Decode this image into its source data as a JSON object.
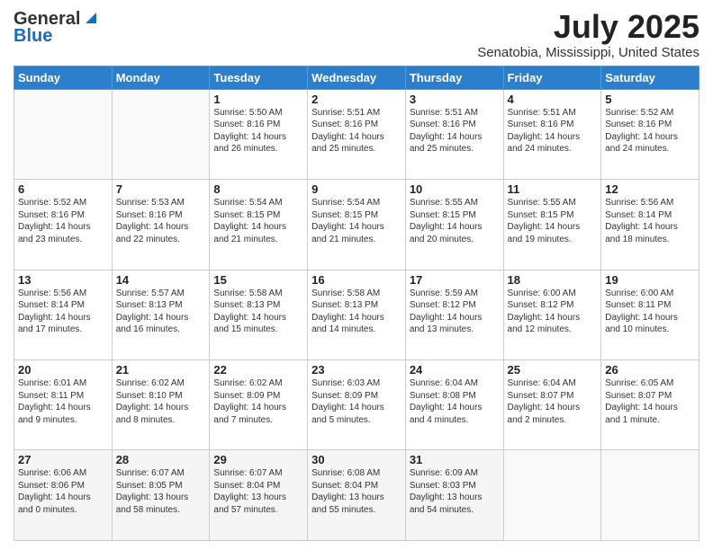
{
  "logo": {
    "line1": "General",
    "line2": "Blue"
  },
  "header": {
    "month": "July 2025",
    "location": "Senatobia, Mississippi, United States"
  },
  "weekdays": [
    "Sunday",
    "Monday",
    "Tuesday",
    "Wednesday",
    "Thursday",
    "Friday",
    "Saturday"
  ],
  "weeks": [
    [
      {
        "day": "",
        "sunrise": "",
        "sunset": "",
        "daylight": ""
      },
      {
        "day": "",
        "sunrise": "",
        "sunset": "",
        "daylight": ""
      },
      {
        "day": "1",
        "sunrise": "Sunrise: 5:50 AM",
        "sunset": "Sunset: 8:16 PM",
        "daylight": "Daylight: 14 hours and 26 minutes."
      },
      {
        "day": "2",
        "sunrise": "Sunrise: 5:51 AM",
        "sunset": "Sunset: 8:16 PM",
        "daylight": "Daylight: 14 hours and 25 minutes."
      },
      {
        "day": "3",
        "sunrise": "Sunrise: 5:51 AM",
        "sunset": "Sunset: 8:16 PM",
        "daylight": "Daylight: 14 hours and 25 minutes."
      },
      {
        "day": "4",
        "sunrise": "Sunrise: 5:51 AM",
        "sunset": "Sunset: 8:16 PM",
        "daylight": "Daylight: 14 hours and 24 minutes."
      },
      {
        "day": "5",
        "sunrise": "Sunrise: 5:52 AM",
        "sunset": "Sunset: 8:16 PM",
        "daylight": "Daylight: 14 hours and 24 minutes."
      }
    ],
    [
      {
        "day": "6",
        "sunrise": "Sunrise: 5:52 AM",
        "sunset": "Sunset: 8:16 PM",
        "daylight": "Daylight: 14 hours and 23 minutes."
      },
      {
        "day": "7",
        "sunrise": "Sunrise: 5:53 AM",
        "sunset": "Sunset: 8:16 PM",
        "daylight": "Daylight: 14 hours and 22 minutes."
      },
      {
        "day": "8",
        "sunrise": "Sunrise: 5:54 AM",
        "sunset": "Sunset: 8:15 PM",
        "daylight": "Daylight: 14 hours and 21 minutes."
      },
      {
        "day": "9",
        "sunrise": "Sunrise: 5:54 AM",
        "sunset": "Sunset: 8:15 PM",
        "daylight": "Daylight: 14 hours and 21 minutes."
      },
      {
        "day": "10",
        "sunrise": "Sunrise: 5:55 AM",
        "sunset": "Sunset: 8:15 PM",
        "daylight": "Daylight: 14 hours and 20 minutes."
      },
      {
        "day": "11",
        "sunrise": "Sunrise: 5:55 AM",
        "sunset": "Sunset: 8:15 PM",
        "daylight": "Daylight: 14 hours and 19 minutes."
      },
      {
        "day": "12",
        "sunrise": "Sunrise: 5:56 AM",
        "sunset": "Sunset: 8:14 PM",
        "daylight": "Daylight: 14 hours and 18 minutes."
      }
    ],
    [
      {
        "day": "13",
        "sunrise": "Sunrise: 5:56 AM",
        "sunset": "Sunset: 8:14 PM",
        "daylight": "Daylight: 14 hours and 17 minutes."
      },
      {
        "day": "14",
        "sunrise": "Sunrise: 5:57 AM",
        "sunset": "Sunset: 8:13 PM",
        "daylight": "Daylight: 14 hours and 16 minutes."
      },
      {
        "day": "15",
        "sunrise": "Sunrise: 5:58 AM",
        "sunset": "Sunset: 8:13 PM",
        "daylight": "Daylight: 14 hours and 15 minutes."
      },
      {
        "day": "16",
        "sunrise": "Sunrise: 5:58 AM",
        "sunset": "Sunset: 8:13 PM",
        "daylight": "Daylight: 14 hours and 14 minutes."
      },
      {
        "day": "17",
        "sunrise": "Sunrise: 5:59 AM",
        "sunset": "Sunset: 8:12 PM",
        "daylight": "Daylight: 14 hours and 13 minutes."
      },
      {
        "day": "18",
        "sunrise": "Sunrise: 6:00 AM",
        "sunset": "Sunset: 8:12 PM",
        "daylight": "Daylight: 14 hours and 12 minutes."
      },
      {
        "day": "19",
        "sunrise": "Sunrise: 6:00 AM",
        "sunset": "Sunset: 8:11 PM",
        "daylight": "Daylight: 14 hours and 10 minutes."
      }
    ],
    [
      {
        "day": "20",
        "sunrise": "Sunrise: 6:01 AM",
        "sunset": "Sunset: 8:11 PM",
        "daylight": "Daylight: 14 hours and 9 minutes."
      },
      {
        "day": "21",
        "sunrise": "Sunrise: 6:02 AM",
        "sunset": "Sunset: 8:10 PM",
        "daylight": "Daylight: 14 hours and 8 minutes."
      },
      {
        "day": "22",
        "sunrise": "Sunrise: 6:02 AM",
        "sunset": "Sunset: 8:09 PM",
        "daylight": "Daylight: 14 hours and 7 minutes."
      },
      {
        "day": "23",
        "sunrise": "Sunrise: 6:03 AM",
        "sunset": "Sunset: 8:09 PM",
        "daylight": "Daylight: 14 hours and 5 minutes."
      },
      {
        "day": "24",
        "sunrise": "Sunrise: 6:04 AM",
        "sunset": "Sunset: 8:08 PM",
        "daylight": "Daylight: 14 hours and 4 minutes."
      },
      {
        "day": "25",
        "sunrise": "Sunrise: 6:04 AM",
        "sunset": "Sunset: 8:07 PM",
        "daylight": "Daylight: 14 hours and 2 minutes."
      },
      {
        "day": "26",
        "sunrise": "Sunrise: 6:05 AM",
        "sunset": "Sunset: 8:07 PM",
        "daylight": "Daylight: 14 hours and 1 minute."
      }
    ],
    [
      {
        "day": "27",
        "sunrise": "Sunrise: 6:06 AM",
        "sunset": "Sunset: 8:06 PM",
        "daylight": "Daylight: 14 hours and 0 minutes."
      },
      {
        "day": "28",
        "sunrise": "Sunrise: 6:07 AM",
        "sunset": "Sunset: 8:05 PM",
        "daylight": "Daylight: 13 hours and 58 minutes."
      },
      {
        "day": "29",
        "sunrise": "Sunrise: 6:07 AM",
        "sunset": "Sunset: 8:04 PM",
        "daylight": "Daylight: 13 hours and 57 minutes."
      },
      {
        "day": "30",
        "sunrise": "Sunrise: 6:08 AM",
        "sunset": "Sunset: 8:04 PM",
        "daylight": "Daylight: 13 hours and 55 minutes."
      },
      {
        "day": "31",
        "sunrise": "Sunrise: 6:09 AM",
        "sunset": "Sunset: 8:03 PM",
        "daylight": "Daylight: 13 hours and 54 minutes."
      },
      {
        "day": "",
        "sunrise": "",
        "sunset": "",
        "daylight": ""
      },
      {
        "day": "",
        "sunrise": "",
        "sunset": "",
        "daylight": ""
      }
    ]
  ]
}
